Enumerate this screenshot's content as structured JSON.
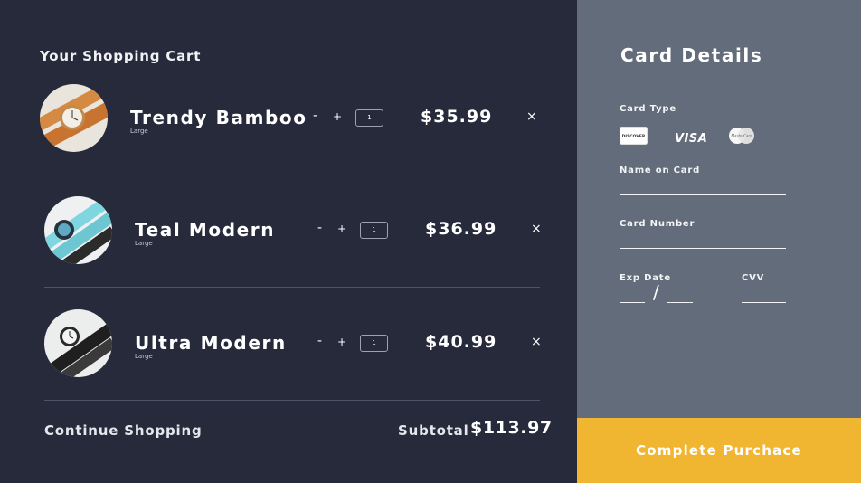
{
  "cart": {
    "title": "Your Shopping Cart",
    "items": [
      {
        "name": "Trendy Bamboo",
        "size": "Large",
        "minus": "-",
        "plus": "+",
        "qty": "1",
        "price": "$35.99",
        "remove": "×"
      },
      {
        "name": "Teal Modern",
        "size": "Large",
        "minus": "-",
        "plus": "+",
        "qty": "1",
        "price": "$36.99",
        "remove": "×"
      },
      {
        "name": "Ultra Modern",
        "size": "Large",
        "minus": "-",
        "plus": "+",
        "qty": "1",
        "price": "$40.99",
        "remove": "×"
      }
    ],
    "continue_label": "Continue Shopping",
    "subtotal_label": "Subtotal",
    "subtotal_value": "$113.97"
  },
  "card": {
    "title": "Card Details",
    "card_type_label": "Card Type",
    "logos": {
      "discover": "DISCOVER",
      "visa": "VISA",
      "mastercard": "MasterCard"
    },
    "name_label": "Name on Card",
    "number_label": "Card Number",
    "exp_label": "Exp Date",
    "exp_separator": "/",
    "cvv_label": "CVV"
  },
  "purchase": {
    "label": "Complete Purchace"
  },
  "colors": {
    "background": "#262a3b",
    "card_panel": "#636c7a",
    "accent": "#f1b631",
    "divider": "#4d5266"
  },
  "icons": {
    "remove": "close-icon",
    "watches": [
      "bamboo-watch-image",
      "teal-watch-image",
      "ultra-watch-image"
    ]
  }
}
